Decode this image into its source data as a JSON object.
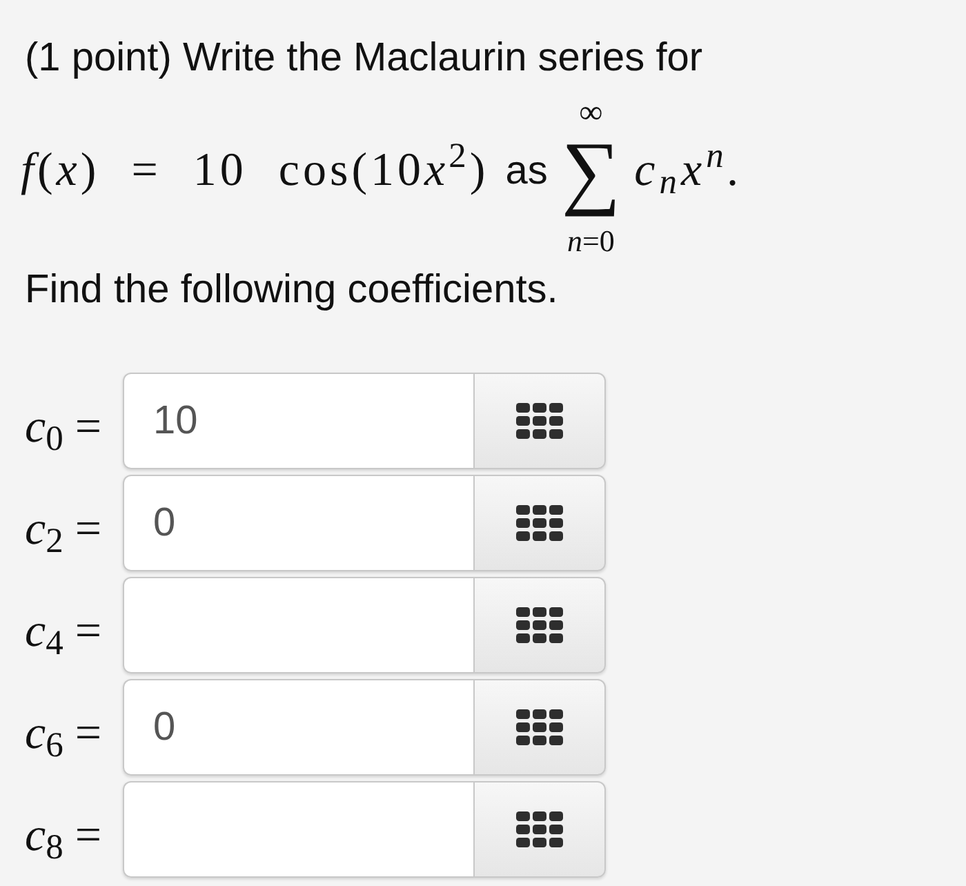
{
  "question": {
    "intro": "(1 point) Write the Maclaurin series for",
    "function": "*f*(*x*) = 10 cos(10⁢*x*$^{2}$)",
    "connector": "as",
    "sum": {
      "symbol": "∑",
      "upper": "∞",
      "lower": "*n*=0",
      "term": "c$_{n}$x$^{n}$."
    },
    "instruction": "Find the following coefficients."
  },
  "answers": [
    {
      "label": "*c*$_{0}$ =",
      "value": "10"
    },
    {
      "label": "*c*$_{2}$ =",
      "value": "0"
    },
    {
      "label": "*c*$_{4}$ ="
    },
    {
      "label": "*c*$_{6}$ =",
      "value": "0"
    },
    {
      "label": "*c*$_{8}$ ="
    }
  ]
}
